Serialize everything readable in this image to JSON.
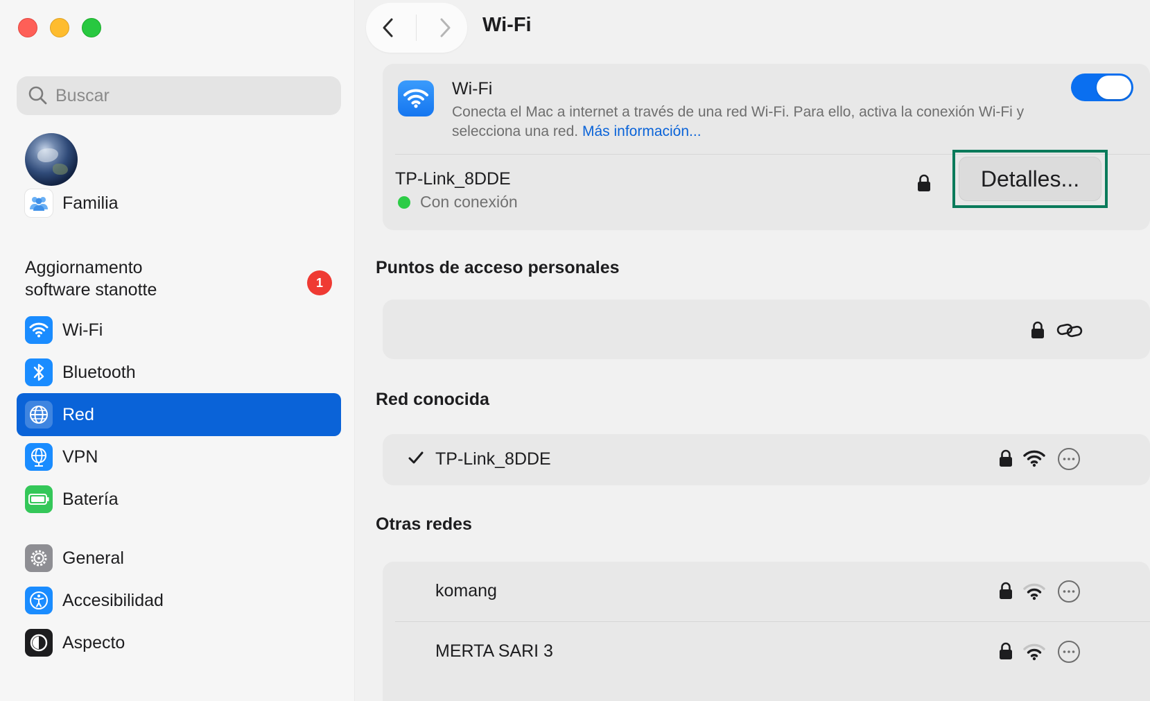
{
  "window": {
    "buttons": [
      "close",
      "minimize",
      "zoom"
    ]
  },
  "sidebar": {
    "search": {
      "placeholder": "Buscar"
    },
    "family_label": "Familia",
    "update": {
      "line1": "Aggiornamento",
      "line2": "software stanotte",
      "badge": "1"
    },
    "items": [
      {
        "label": "Wi-Fi",
        "icon": "wifi-icon",
        "color": "#1a8cff"
      },
      {
        "label": "Bluetooth",
        "icon": "bluetooth-icon",
        "color": "#1a8cff"
      },
      {
        "label": "Red",
        "icon": "globe-icon",
        "color": "#1a8cff",
        "active": true
      },
      {
        "label": "VPN",
        "icon": "vpn-globe-icon",
        "color": "#1a8cff"
      },
      {
        "label": "Batería",
        "icon": "battery-icon",
        "color": "#34c759"
      },
      {
        "label": "General",
        "icon": "gear-icon",
        "color": "#8e8e93"
      },
      {
        "label": "Accesibilidad",
        "icon": "accessibility-icon",
        "color": "#1a8cff"
      },
      {
        "label": "Aspecto",
        "icon": "appearance-icon",
        "color": "#1d1d1f"
      }
    ]
  },
  "header": {
    "title": "Wi-Fi"
  },
  "wifi_card": {
    "title": "Wi-Fi",
    "description": "Conecta el Mac a internet a través de una red Wi-Fi. Para ello, activa la conexión Wi-Fi y selecciona una red.",
    "link": "Más información...",
    "toggle_on": true,
    "current_network": "TP-Link_8DDE",
    "status": "Con conexión",
    "details_button": "Detalles..."
  },
  "sections": {
    "hotspots": "Puntos de acceso personales",
    "known": "Red conocida",
    "others": "Otras redes"
  },
  "known_networks": [
    {
      "name": "TP-Link_8DDE",
      "checked": true
    }
  ],
  "other_networks": [
    {
      "name": "komang"
    },
    {
      "name": "MERTA SARI 3"
    }
  ],
  "colors": {
    "accent": "#0a63d8",
    "highlight_frame": "#0a7a5a",
    "connected": "#2ccc46",
    "badge": "#ef3a33"
  }
}
